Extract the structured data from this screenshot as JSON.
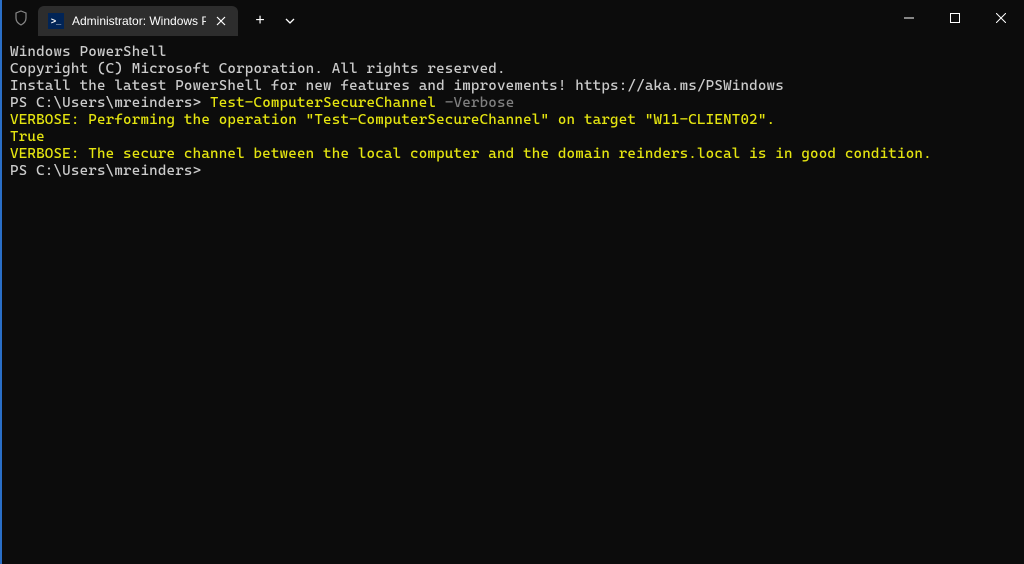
{
  "tab": {
    "title": "Administrator: Windows Powe"
  },
  "terminal": {
    "line1": "Windows PowerShell",
    "line2": "Copyright (C) Microsoft Corporation. All rights reserved.",
    "line3": "",
    "line4": "Install the latest PowerShell for new features and improvements! https://aka.ms/PSWindows",
    "line5": "",
    "prompt1": "PS C:\\Users\\mreinders> ",
    "cmd1": "Test-ComputerSecureChannel",
    "cmd1_arg": " -Verbose",
    "verbose1": "VERBOSE: Performing the operation \"Test-ComputerSecureChannel\" on target \"W11-CLIENT02\".",
    "result": "True",
    "verbose2": "VERBOSE: The secure channel between the local computer and the domain reinders.local is in good condition.",
    "prompt2": "PS C:\\Users\\mreinders>"
  }
}
